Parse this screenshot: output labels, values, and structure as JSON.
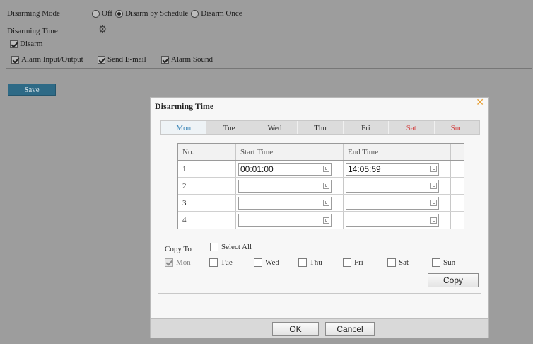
{
  "settings": {
    "disarming_mode_label": "Disarming Mode",
    "mode_options": [
      "Off",
      "Disarm by Schedule",
      "Disarm Once"
    ],
    "mode_selected": "Disarm by Schedule",
    "disarming_time_label": "Disarming Time",
    "disarm_group_label": "Disarm",
    "disarm_checked": true,
    "actions": [
      {
        "label": "Alarm Input/Output",
        "checked": true
      },
      {
        "label": "Send E-mail",
        "checked": true
      },
      {
        "label": "Alarm Sound",
        "checked": true
      }
    ],
    "save_label": "Save",
    "icons": {
      "settings": "gear-icon"
    }
  },
  "dialog": {
    "title": "Disarming Time",
    "close_icon": "close-icon",
    "days": [
      "Mon",
      "Tue",
      "Wed",
      "Thu",
      "Fri",
      "Sat",
      "Sun"
    ],
    "active_day": "Mon",
    "weekend_color": "#d24a4a",
    "active_color": "#3a86b8",
    "table": {
      "headers": [
        "No.",
        "Start Time",
        "End Time"
      ],
      "rows": [
        {
          "no": "1",
          "start": "00:01:00",
          "end": "14:05:59"
        },
        {
          "no": "2",
          "start": "",
          "end": ""
        },
        {
          "no": "3",
          "start": "",
          "end": ""
        },
        {
          "no": "4",
          "start": "",
          "end": ""
        }
      ]
    },
    "copy_to_label": "Copy To",
    "select_all_label": "Select All",
    "copy_days": [
      {
        "label": "Mon",
        "checked": true,
        "disabled": true
      },
      {
        "label": "Tue",
        "checked": false
      },
      {
        "label": "Wed",
        "checked": false
      },
      {
        "label": "Thu",
        "checked": false
      },
      {
        "label": "Fri",
        "checked": false
      },
      {
        "label": "Sat",
        "checked": false
      },
      {
        "label": "Sun",
        "checked": false
      }
    ],
    "copy_label": "Copy",
    "ok_label": "OK",
    "cancel_label": "Cancel"
  }
}
